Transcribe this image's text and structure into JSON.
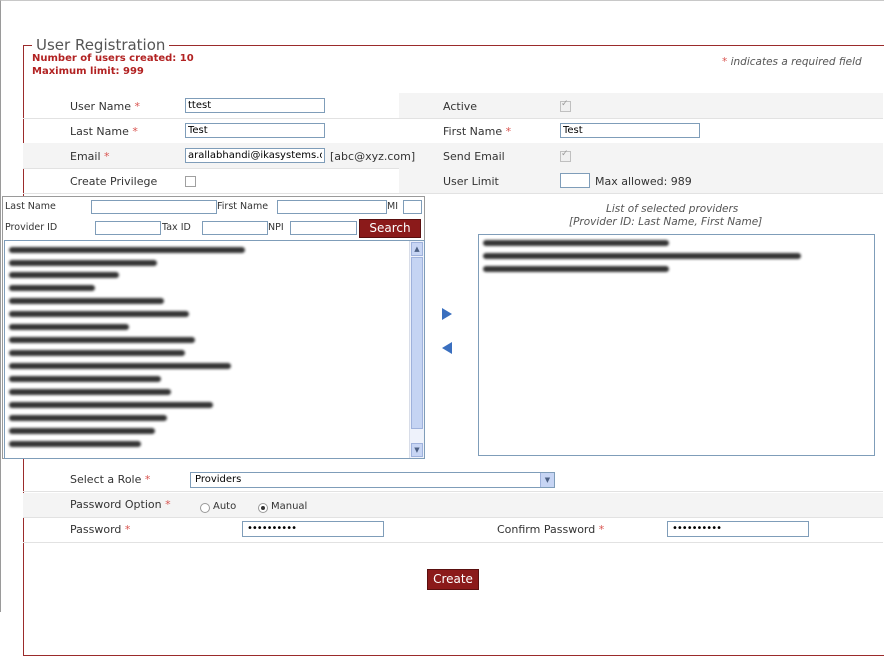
{
  "legend": "User Registration",
  "status": {
    "users_created": "Number of users created: 10",
    "max_limit": "Maximum limit: 999"
  },
  "required_note_star": "*",
  "required_note_text": " indicates a required field",
  "form": {
    "user_name_label": "User Name",
    "user_name_value": "ttest",
    "active_label": "Active",
    "last_name_label": "Last Name",
    "last_name_value": "Test",
    "first_name_label": "First Name",
    "first_name_value": "Test",
    "email_label": "Email",
    "email_value": "arallabhandi@ikasystems.c",
    "email_hint": "[abc@xyz.com]",
    "send_email_label": "Send Email",
    "create_privilege_label": "Create Privilege",
    "user_limit_label": "User Limit",
    "user_limit_value": "",
    "max_allowed": "Max allowed: 989",
    "required_star": "*"
  },
  "search": {
    "last_name_label": "Last Name",
    "first_name_label": "First Name",
    "mi_label": "MI",
    "provider_id_label": "Provider ID",
    "tax_id_label": "Tax ID",
    "npi_label": "NPI",
    "search_button": "Search"
  },
  "selected": {
    "title_line1": "List of selected providers",
    "title_line2": "[Provider ID: Last Name, First Name]"
  },
  "role": {
    "label": "Select a Role",
    "value": "Providers"
  },
  "password_option": {
    "label": "Password Option",
    "auto": "Auto",
    "manual": "Manual",
    "selected": "Manual"
  },
  "password": {
    "label": "Password",
    "value": "••••••••••",
    "confirm_label": "Confirm Password",
    "confirm_value": "••••••••••"
  },
  "create_button": "Create",
  "colors": {
    "accent": "#8b1a1a",
    "required": "#d9534f",
    "status": "#b22222"
  }
}
